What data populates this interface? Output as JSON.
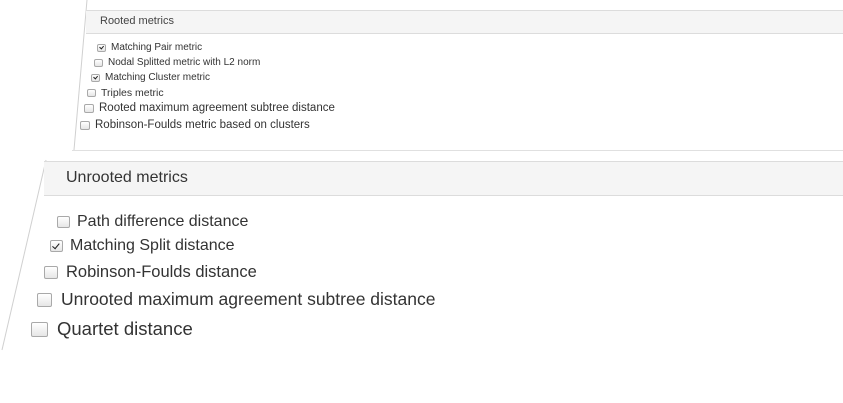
{
  "rooted": {
    "title": "Rooted metrics",
    "options": [
      {
        "label": "Matching Pair metric",
        "checked": true
      },
      {
        "label": "Nodal Splitted metric with L2 norm",
        "checked": false
      },
      {
        "label": "Matching Cluster metric",
        "checked": true
      },
      {
        "label": "Triples metric",
        "checked": false
      },
      {
        "label": "Rooted maximum agreement subtree distance",
        "checked": false
      },
      {
        "label": "Robinson-Foulds metric based on clusters",
        "checked": false
      }
    ]
  },
  "unrooted": {
    "title": "Unrooted metrics",
    "options": [
      {
        "label": "Path difference distance",
        "checked": false
      },
      {
        "label": "Matching Split distance",
        "checked": true
      },
      {
        "label": "Robinson-Foulds distance",
        "checked": false
      },
      {
        "label": "Unrooted maximum agreement subtree distance",
        "checked": false
      },
      {
        "label": "Quartet distance",
        "checked": false
      }
    ]
  },
  "colors": {
    "header_bg": "#f5f5f5",
    "border": "#dcdcdc",
    "text": "#333333"
  }
}
